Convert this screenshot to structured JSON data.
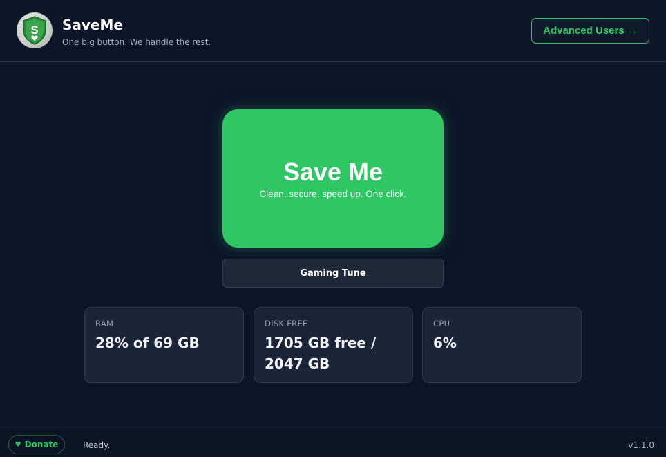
{
  "header": {
    "title": "SaveMe",
    "subtitle": "One big button. We handle the rest.",
    "advanced_label": "Advanced Users →",
    "logo_icon": "shield-heart-icon"
  },
  "main": {
    "save_title": "Save Me",
    "save_subtitle": "Clean, secure, speed up. One click.",
    "gaming_label": "Gaming Tune"
  },
  "stats": [
    {
      "label": "RAM",
      "value": "28% of 69 GB"
    },
    {
      "label": "DISK FREE",
      "value": "1705 GB free / 2047 GB"
    },
    {
      "label": "CPU",
      "value": "6%"
    }
  ],
  "footer": {
    "donate_label": "Donate",
    "donate_icon": "heart-icon",
    "status": "Ready.",
    "version": "v1.1.0"
  },
  "colors": {
    "accent": "#2ec764",
    "background": "#0d1529",
    "card": "#1b2537"
  }
}
